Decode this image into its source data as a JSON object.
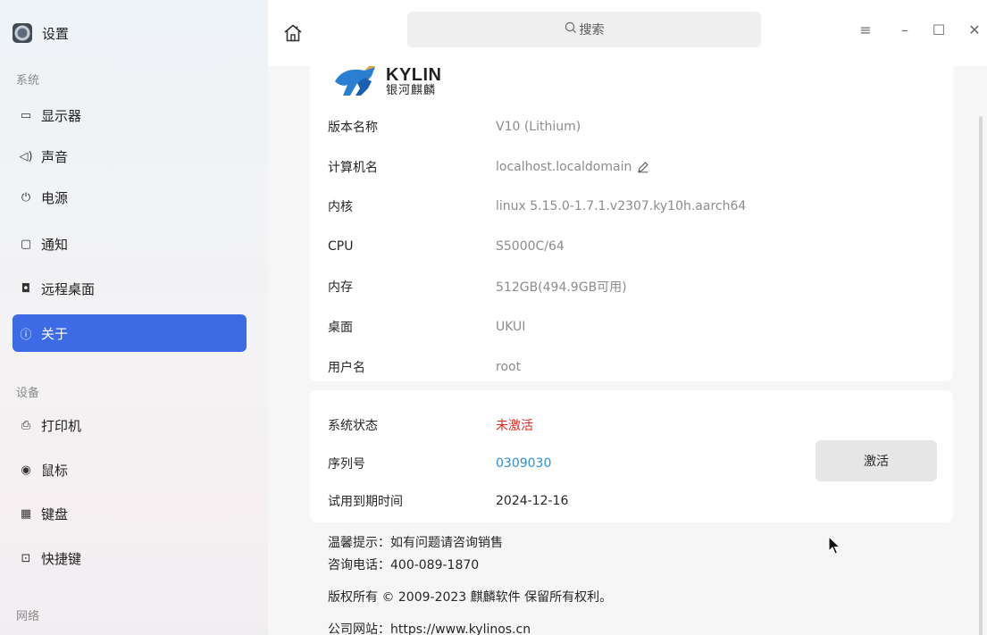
{
  "app": {
    "title": "设置"
  },
  "sidebar": {
    "groups": [
      {
        "title": "系统"
      },
      {
        "title": "设备"
      },
      {
        "title": "网络"
      }
    ],
    "items": [
      {
        "label": "显示器",
        "icon": "monitor-icon",
        "glyph": "▭"
      },
      {
        "label": "声音",
        "icon": "speaker-icon",
        "glyph": "◁)"
      },
      {
        "label": "电源",
        "icon": "power-icon",
        "glyph": "⏻"
      },
      {
        "label": "通知",
        "icon": "notification-icon",
        "glyph": "▢"
      },
      {
        "label": "远程桌面",
        "icon": "remote-desktop-icon",
        "glyph": "◘"
      },
      {
        "label": "关于",
        "icon": "info-icon",
        "glyph": "ⓘ",
        "active": true
      },
      {
        "label": "打印机",
        "icon": "printer-icon",
        "glyph": "⎙"
      },
      {
        "label": "鼠标",
        "icon": "mouse-icon",
        "glyph": "◉"
      },
      {
        "label": "键盘",
        "icon": "keyboard-icon",
        "glyph": "▦"
      },
      {
        "label": "快捷键",
        "icon": "shortcut-icon",
        "glyph": "⊡"
      }
    ]
  },
  "search": {
    "label": "搜索"
  },
  "window_controls": [
    {
      "name": "menu",
      "glyph": "≡"
    },
    {
      "name": "minimize",
      "glyph": "–"
    },
    {
      "name": "maximize",
      "glyph": "☐"
    },
    {
      "name": "close",
      "glyph": "✕"
    }
  ],
  "logo": {
    "en": "KYLIN",
    "cn": "银河麒麟"
  },
  "system_info": [
    {
      "label": "版本名称",
      "value": "V10 (Lithium)"
    },
    {
      "label": "计算机名",
      "value": "localhost.localdomain",
      "editable": true
    },
    {
      "label": "内核",
      "value": "linux 5.15.0-1.7.1.v2307.ky10h.aarch64"
    },
    {
      "label": "CPU",
      "value": "S5000C/64"
    },
    {
      "label": "内存",
      "value": "512GB(494.9GB可用)"
    },
    {
      "label": "桌面",
      "value": "UKUI"
    },
    {
      "label": "用户名",
      "value": "root"
    }
  ],
  "activation": {
    "status_label": "系统状态",
    "status_value": "未激活",
    "serial_label": "序列号",
    "serial_value": "0309030",
    "expiry_label": "试用到期时间",
    "expiry_value": "2024-12-16",
    "button_label": "激活"
  },
  "footer": {
    "tip": "温馨提示：如有问题请咨询销售",
    "phone": "咨询电话：400-089-1870",
    "copyright": "版权所有 © 2009-2023 麒麟软件 保留所有权利。",
    "website": "公司网站：https://www.kylinos.cn"
  },
  "colors": {
    "accent": "#3d6be5",
    "status_inactive": "#e5281e",
    "serial_link": "#2e8fd6"
  }
}
